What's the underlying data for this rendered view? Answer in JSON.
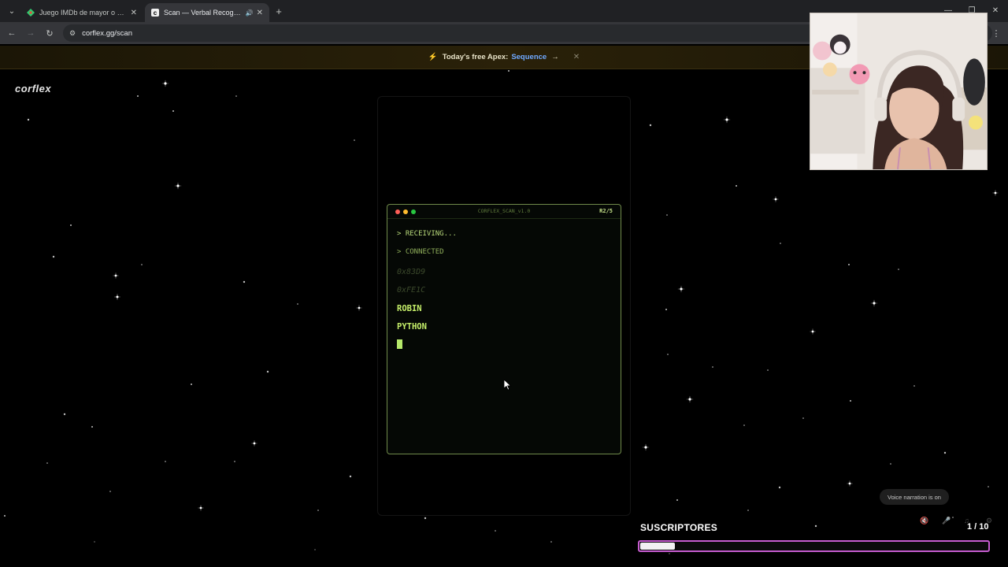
{
  "browser": {
    "tabs": [
      {
        "title": "Juego IMDb de mayor o menor",
        "active": false
      },
      {
        "title": "Scan — Verbal Recognition",
        "active": true
      }
    ],
    "url": "corflex.gg/scan"
  },
  "banner": {
    "label": "Today's free Apex:",
    "link": "Sequence",
    "arrow": "→",
    "close": "✕"
  },
  "site": {
    "logo": "corflex"
  },
  "terminal": {
    "title": "CORFLEX_SCAN_v1.0",
    "round": "R2/5",
    "status_lines": [
      "> RECEIVING...",
      "> CONNECTED"
    ],
    "hex_lines": [
      "0x83D9",
      "0xFE1C"
    ],
    "words": [
      "ROBIN",
      "PYTHON"
    ]
  },
  "overlay": {
    "narration": "Voice narration is on",
    "subscribers_label": "SUSCRIPTORES",
    "subscribers_count": "1 / 10",
    "subscribers_progress": 0.1
  },
  "colors": {
    "terminal_green": "#c6f06a",
    "banner_link": "#6fa8ff",
    "progress_border": "#c65ccf"
  }
}
